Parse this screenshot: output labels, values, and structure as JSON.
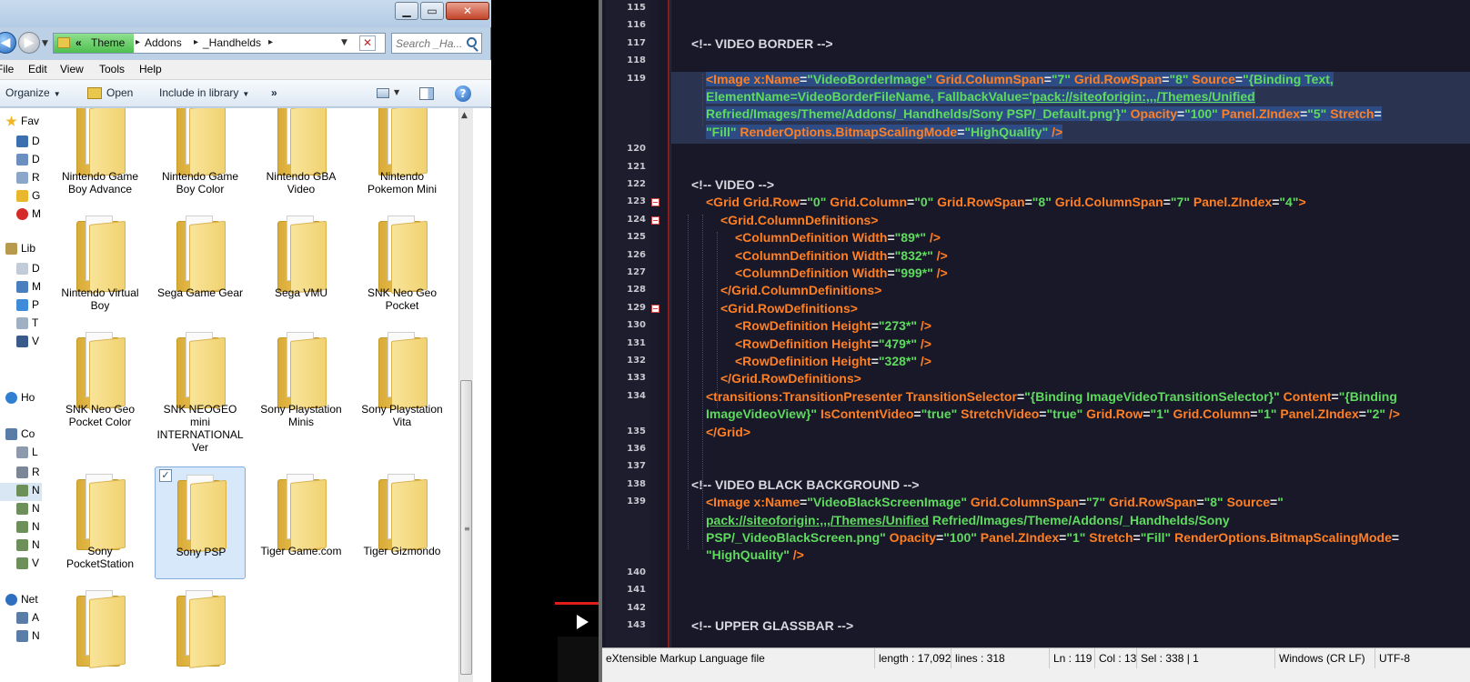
{
  "explorer": {
    "window_buttons": {
      "minimize": "▁",
      "maximize": "▭",
      "close": "✕"
    },
    "nav": {
      "back": "◀",
      "forward": "▶"
    },
    "address": {
      "overflow": "«",
      "crumbs": [
        "Theme",
        "Addons",
        "_Handhelds"
      ],
      "separator": "▸"
    },
    "search_placeholder": "Search _Ha...",
    "menubar": [
      "File",
      "Edit",
      "View",
      "Tools",
      "Help"
    ],
    "toolbar": {
      "organize": "Organize",
      "open": "Open",
      "include": "Include in library",
      "more": "»",
      "help": "?"
    },
    "nav_pane": [
      {
        "label": "Fav",
        "icon": "star-icon",
        "color": "#f0b62a"
      },
      {
        "label": "D",
        "icon": "desktop-icon",
        "color": "#3c6fb0"
      },
      {
        "label": "D",
        "icon": "downloads-icon",
        "color": "#6b8fbf"
      },
      {
        "label": "R",
        "icon": "recent-places-icon",
        "color": "#8aa7c9"
      },
      {
        "label": "G",
        "icon": "google-drive-icon",
        "color": "#e8b72d"
      },
      {
        "label": "M",
        "icon": "mega-icon",
        "color": "#d42a2a"
      },
      {
        "label": "Lib",
        "icon": "libraries-icon",
        "color": "#b89a4c"
      },
      {
        "label": "D",
        "icon": "documents-icon",
        "color": "#c2ccd8"
      },
      {
        "label": "M",
        "icon": "music-icon",
        "color": "#4a7fbf"
      },
      {
        "label": "P",
        "icon": "pictures-icon",
        "color": "#3d8bd9"
      },
      {
        "label": "T",
        "icon": "text-icon",
        "color": "#9fb0c3"
      },
      {
        "label": "V",
        "icon": "videos-icon",
        "color": "#3a5a8a"
      },
      {
        "label": "Ho",
        "icon": "homegroup-icon",
        "color": "#2f7fd2"
      },
      {
        "label": "Co",
        "icon": "computer-icon",
        "color": "#5a7da8"
      },
      {
        "label": "L",
        "icon": "local-disk-icon",
        "color": "#8c9aab"
      },
      {
        "label": "R",
        "icon": "removable-disk-icon",
        "color": "#7b8696"
      },
      {
        "label": "N",
        "icon": "network-drive-icon",
        "color": "#6d8f5a"
      },
      {
        "label": "N",
        "icon": "network-drive-icon",
        "color": "#6d8f5a"
      },
      {
        "label": "N",
        "icon": "network-drive-icon",
        "color": "#6d8f5a"
      },
      {
        "label": "N",
        "icon": "network-drive-icon",
        "color": "#6d8f5a"
      },
      {
        "label": "V",
        "icon": "network-drive-icon",
        "color": "#6d8f5a"
      },
      {
        "label": "Net",
        "icon": "network-icon",
        "color": "#2f6fbf"
      },
      {
        "label": "A",
        "icon": "computer-icon",
        "color": "#5a7da8"
      },
      {
        "label": "N",
        "icon": "computer-icon",
        "color": "#5a7da8"
      }
    ],
    "folders": [
      {
        "label": "Nintendo Game Boy Advance"
      },
      {
        "label": "Nintendo Game Boy Color"
      },
      {
        "label": "Nintendo GBA Video"
      },
      {
        "label": "Nintendo Pokemon Mini"
      },
      {
        "label": "Nintendo Virtual Boy"
      },
      {
        "label": "Sega Game Gear"
      },
      {
        "label": "Sega VMU"
      },
      {
        "label": "SNK Neo Geo Pocket"
      },
      {
        "label": "SNK Neo Geo Pocket Color"
      },
      {
        "label": "SNK NEOGEO mini INTERNATIONAL Ver"
      },
      {
        "label": "Sony Playstation Minis"
      },
      {
        "label": "Sony Playstation Vita"
      },
      {
        "label": "Sony PocketStation"
      },
      {
        "label": "Sony PSP",
        "selected": true,
        "checkmark": "✓"
      },
      {
        "label": "Tiger Game.com"
      },
      {
        "label": "Tiger Gizmondo"
      },
      {
        "label": ""
      },
      {
        "label": ""
      }
    ]
  },
  "editor": {
    "lines": [
      {
        "num": "115",
        "tokens": []
      },
      {
        "num": "116",
        "tokens": []
      },
      {
        "num": "117",
        "indent": 1,
        "tokens": [
          [
            "comment",
            "<!-- VIDEO BORDER -->"
          ]
        ]
      },
      {
        "num": "118",
        "tokens": []
      },
      {
        "num": "119",
        "indent": 2,
        "selected": true,
        "tokens": [
          [
            "tag",
            "<Image x:Name"
          ],
          [
            "eq",
            "="
          ],
          [
            "str",
            "\"VideoBorderImage\""
          ],
          [
            "tag",
            " Grid.ColumnSpan"
          ],
          [
            "eq",
            "="
          ],
          [
            "str",
            "\"7\""
          ],
          [
            "tag",
            " Grid.RowSpan"
          ],
          [
            "eq",
            "="
          ],
          [
            "str",
            "\"8\""
          ],
          [
            "tag",
            " Source"
          ],
          [
            "eq",
            "="
          ],
          [
            "str",
            "\"{Binding Text,"
          ]
        ]
      },
      {
        "num": "",
        "indent": 2,
        "selected": true,
        "tokens": [
          [
            "str",
            "ElementName=VideoBorderFileName, FallbackValue='"
          ],
          [
            "link",
            "pack://siteoforigin:,,,/Themes/Unified"
          ]
        ]
      },
      {
        "num": "",
        "indent": 2,
        "selected": true,
        "tokens": [
          [
            "str",
            "Refried/Images/Theme/Addons/_Handhelds/Sony PSP/_Default.png'}\""
          ],
          [
            "tag",
            " Opacity"
          ],
          [
            "eq",
            "="
          ],
          [
            "str",
            "\"100\""
          ],
          [
            "tag",
            " Panel.ZIndex"
          ],
          [
            "eq",
            "="
          ],
          [
            "str",
            "\"5\""
          ],
          [
            "tag",
            " Stretch"
          ],
          [
            "eq",
            "="
          ]
        ]
      },
      {
        "num": "",
        "indent": 2,
        "selected": true,
        "tokens": [
          [
            "str",
            "\"Fill\""
          ],
          [
            "tag",
            " RenderOptions.BitmapScalingMode"
          ],
          [
            "eq",
            "="
          ],
          [
            "str",
            "\"HighQuality\""
          ],
          [
            "tag",
            " />"
          ]
        ]
      },
      {
        "num": "120",
        "tokens": []
      },
      {
        "num": "121",
        "tokens": []
      },
      {
        "num": "122",
        "indent": 1,
        "tokens": [
          [
            "comment",
            "<!-- VIDEO -->"
          ]
        ]
      },
      {
        "num": "123",
        "indent": 2,
        "fold": true,
        "tokens": [
          [
            "tag",
            "<Grid Grid.Row"
          ],
          [
            "eq",
            "="
          ],
          [
            "str",
            "\"0\""
          ],
          [
            "tag",
            " Grid.Column"
          ],
          [
            "eq",
            "="
          ],
          [
            "str",
            "\"0\""
          ],
          [
            "tag",
            " Grid.RowSpan"
          ],
          [
            "eq",
            "="
          ],
          [
            "str",
            "\"8\""
          ],
          [
            "tag",
            " Grid.ColumnSpan"
          ],
          [
            "eq",
            "="
          ],
          [
            "str",
            "\"7\""
          ],
          [
            "tag",
            " Panel.ZIndex"
          ],
          [
            "eq",
            "="
          ],
          [
            "str",
            "\"4\""
          ],
          [
            "tag",
            ">"
          ]
        ]
      },
      {
        "num": "124",
        "indent": 3,
        "fold": true,
        "tokens": [
          [
            "tag",
            "<Grid.ColumnDefinitions>"
          ]
        ]
      },
      {
        "num": "125",
        "indent": 4,
        "tokens": [
          [
            "tag",
            "<ColumnDefinition Width"
          ],
          [
            "eq",
            "="
          ],
          [
            "str",
            "\"89*\""
          ],
          [
            "tag",
            " />"
          ]
        ]
      },
      {
        "num": "126",
        "indent": 4,
        "tokens": [
          [
            "tag",
            "<ColumnDefinition Width"
          ],
          [
            "eq",
            "="
          ],
          [
            "str",
            "\"832*\""
          ],
          [
            "tag",
            " />"
          ]
        ]
      },
      {
        "num": "127",
        "indent": 4,
        "tokens": [
          [
            "tag",
            "<ColumnDefinition Width"
          ],
          [
            "eq",
            "="
          ],
          [
            "str",
            "\"999*\""
          ],
          [
            "tag",
            " />"
          ]
        ]
      },
      {
        "num": "128",
        "indent": 3,
        "tokens": [
          [
            "tag",
            "</Grid.ColumnDefinitions>"
          ]
        ]
      },
      {
        "num": "129",
        "indent": 3,
        "fold": true,
        "tokens": [
          [
            "tag",
            "<Grid.RowDefinitions>"
          ]
        ]
      },
      {
        "num": "130",
        "indent": 4,
        "tokens": [
          [
            "tag",
            "<RowDefinition Height"
          ],
          [
            "eq",
            "="
          ],
          [
            "str",
            "\"273*\""
          ],
          [
            "tag",
            " />"
          ]
        ]
      },
      {
        "num": "131",
        "indent": 4,
        "tokens": [
          [
            "tag",
            "<RowDefinition Height"
          ],
          [
            "eq",
            "="
          ],
          [
            "str",
            "\"479*\""
          ],
          [
            "tag",
            " />"
          ]
        ]
      },
      {
        "num": "132",
        "indent": 4,
        "tokens": [
          [
            "tag",
            "<RowDefinition Height"
          ],
          [
            "eq",
            "="
          ],
          [
            "str",
            "\"328*\""
          ],
          [
            "tag",
            " />"
          ]
        ]
      },
      {
        "num": "133",
        "indent": 3,
        "tokens": [
          [
            "tag",
            "</Grid.RowDefinitions>"
          ]
        ]
      },
      {
        "num": "134",
        "indent": 2,
        "tokens": [
          [
            "tag",
            "<transitions:TransitionPresenter TransitionSelector"
          ],
          [
            "eq",
            "="
          ],
          [
            "str",
            "\"{Binding ImageVideoTransitionSelector}\""
          ],
          [
            "tag",
            " Content"
          ],
          [
            "eq",
            "="
          ],
          [
            "str",
            "\"{Binding"
          ]
        ]
      },
      {
        "num": "",
        "indent": 2,
        "tokens": [
          [
            "str",
            "ImageVideoView}\""
          ],
          [
            "tag",
            " IsContentVideo"
          ],
          [
            "eq",
            "="
          ],
          [
            "str",
            "\"true\""
          ],
          [
            "tag",
            " StretchVideo"
          ],
          [
            "eq",
            "="
          ],
          [
            "str",
            "\"true\""
          ],
          [
            "tag",
            " Grid.Row"
          ],
          [
            "eq",
            "="
          ],
          [
            "str",
            "\"1\""
          ],
          [
            "tag",
            " Grid.Column"
          ],
          [
            "eq",
            "="
          ],
          [
            "str",
            "\"1\""
          ],
          [
            "tag",
            " Panel.ZIndex"
          ],
          [
            "eq",
            "="
          ],
          [
            "str",
            "\"2\""
          ],
          [
            "tag",
            " />"
          ]
        ]
      },
      {
        "num": "135",
        "indent": 2,
        "tokens": [
          [
            "tag",
            "</Grid>"
          ]
        ]
      },
      {
        "num": "136",
        "tokens": []
      },
      {
        "num": "137",
        "tokens": []
      },
      {
        "num": "138",
        "indent": 1,
        "tokens": [
          [
            "comment",
            "<!-- VIDEO BLACK BACKGROUND -->"
          ]
        ]
      },
      {
        "num": "139",
        "indent": 2,
        "tokens": [
          [
            "tag",
            "<Image x:Name"
          ],
          [
            "eq",
            "="
          ],
          [
            "str",
            "\"VideoBlackScreenImage\""
          ],
          [
            "tag",
            " Grid.ColumnSpan"
          ],
          [
            "eq",
            "="
          ],
          [
            "str",
            "\"7\""
          ],
          [
            "tag",
            " Grid.RowSpan"
          ],
          [
            "eq",
            "="
          ],
          [
            "str",
            "\"8\""
          ],
          [
            "tag",
            " Source"
          ],
          [
            "eq",
            "="
          ],
          [
            "str",
            "\""
          ]
        ]
      },
      {
        "num": "",
        "indent": 2,
        "tokens": [
          [
            "link",
            "pack://siteoforigin:,,,/Themes/Unified"
          ],
          [
            "str",
            " Refried/Images/Theme/Addons/_Handhelds/Sony"
          ]
        ]
      },
      {
        "num": "",
        "indent": 2,
        "tokens": [
          [
            "str",
            "PSP/_VideoBlackScreen.png\""
          ],
          [
            "tag",
            " Opacity"
          ],
          [
            "eq",
            "="
          ],
          [
            "str",
            "\"100\""
          ],
          [
            "tag",
            " Panel.ZIndex"
          ],
          [
            "eq",
            "="
          ],
          [
            "str",
            "\"1\""
          ],
          [
            "tag",
            " Stretch"
          ],
          [
            "eq",
            "="
          ],
          [
            "str",
            "\"Fill\""
          ],
          [
            "tag",
            " RenderOptions.BitmapScalingMode"
          ],
          [
            "eq",
            "="
          ]
        ]
      },
      {
        "num": "",
        "indent": 2,
        "tokens": [
          [
            "str",
            "\"HighQuality\""
          ],
          [
            "tag",
            " />"
          ]
        ]
      },
      {
        "num": "140",
        "tokens": []
      },
      {
        "num": "141",
        "tokens": []
      },
      {
        "num": "142",
        "tokens": []
      },
      {
        "num": "143",
        "indent": 1,
        "tokens": [
          [
            "comment",
            "<!-- UPPER GLASSBAR -->"
          ]
        ]
      }
    ],
    "statusbar": {
      "file_type": "eXtensible Markup Language file",
      "length": "length : 17,092",
      "lines": "lines : 318",
      "ln": "Ln : 119",
      "col": "Col : 13",
      "sel": "Sel : 338 | 1",
      "eol": "Windows (CR LF)",
      "encoding": "UTF-8"
    }
  },
  "video": {
    "play": "▶",
    "accent": "#e21b1b"
  }
}
